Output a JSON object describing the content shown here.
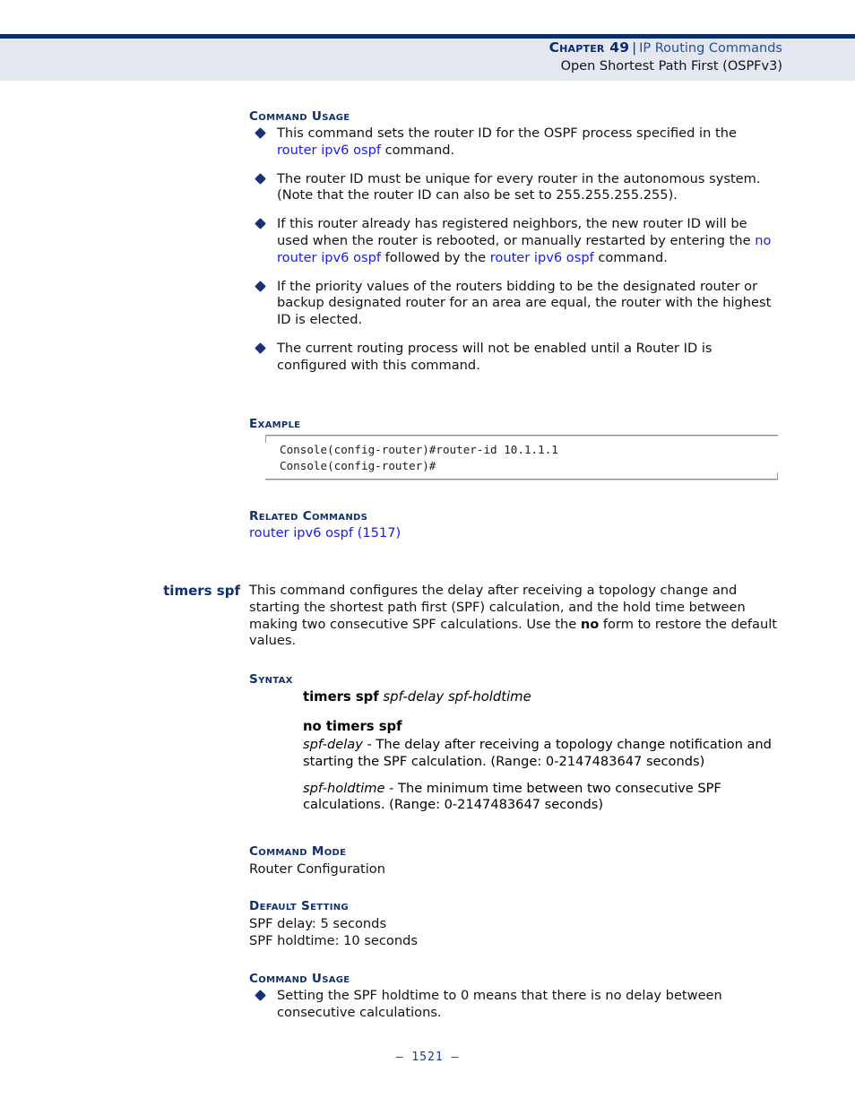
{
  "header": {
    "chapter_label": "Chapter 49",
    "separator": "|",
    "chapter_title": "IP Routing Commands",
    "subtitle": "Open Shortest Path First (OSPFv3)"
  },
  "colors": {
    "navy_rule": "#0a2b72",
    "header_band": "#e3e7f0",
    "heading_navy": "#10306e",
    "link_blue": "#1a1aee",
    "bullet_navy": "#17317a",
    "footer_navy": "#1b3a77"
  },
  "router_id_section": {
    "command_usage_label": "Command Usage",
    "bullets": [
      {
        "parts": [
          {
            "t": "This command sets the router ID for the OSPF process specified in the ",
            "s": "plain"
          },
          {
            "t": "router ipv6 ospf",
            "s": "link"
          },
          {
            "t": " command.",
            "s": "plain"
          }
        ]
      },
      {
        "parts": [
          {
            "t": "The router ID must be unique for every router in the autonomous system. (Note that the router ID can also be set to 255.255.255.255).",
            "s": "plain"
          }
        ]
      },
      {
        "parts": [
          {
            "t": "If this router already has registered neighbors, the new router ID will be used when the router is rebooted, or manually restarted by entering the ",
            "s": "plain"
          },
          {
            "t": "no router ipv6 ospf",
            "s": "link"
          },
          {
            "t": " followed by the ",
            "s": "plain"
          },
          {
            "t": "router ipv6 ospf",
            "s": "link"
          },
          {
            "t": " command.",
            "s": "plain"
          }
        ]
      },
      {
        "parts": [
          {
            "t": "If the priority values of the routers bidding to be the designated router or backup designated router for an area are equal, the router with the highest ID is elected.",
            "s": "plain"
          }
        ]
      },
      {
        "parts": [
          {
            "t": "The current routing process will not be enabled until a Router ID is configured with this command.",
            "s": "plain"
          }
        ]
      }
    ],
    "example_label": "Example",
    "example_console": "Console(config-router)#router-id 10.1.1.1\nConsole(config-router)#",
    "related_commands_label": "Related Commands",
    "related_commands_link": "router ipv6 ospf (1517)"
  },
  "timers_spf": {
    "command_name": "timers spf",
    "description_parts": [
      {
        "t": "This command configures the delay after receiving a topology change and starting the shortest path first (SPF) calculation, and the hold time between making two consecutive SPF calculations. Use the ",
        "s": "plain"
      },
      {
        "t": "no",
        "s": "bold"
      },
      {
        "t": " form to restore the default values.",
        "s": "plain"
      }
    ],
    "syntax_label": "Syntax",
    "syntax_line_1_parts": [
      {
        "t": "timers spf",
        "s": "bold"
      },
      {
        "t": " ",
        "s": "plain"
      },
      {
        "t": "spf-delay spf-holdtime",
        "s": "italic"
      }
    ],
    "syntax_line_2_parts": [
      {
        "t": "no timers spf",
        "s": "bold"
      }
    ],
    "params": [
      {
        "parts": [
          {
            "t": "spf-delay",
            "s": "italic"
          },
          {
            "t": " - The delay after receiving a topology change notification and starting the SPF calculation. (Range: 0-2147483647 seconds)",
            "s": "plain"
          }
        ]
      },
      {
        "parts": [
          {
            "t": "spf-holdtime",
            "s": "italic"
          },
          {
            "t": " - The minimum time between two consecutive SPF calculations. (Range: 0-2147483647 seconds)",
            "s": "plain"
          }
        ]
      }
    ],
    "command_mode_label": "Command Mode",
    "command_mode_value": "Router Configuration",
    "default_setting_label": "Default Setting",
    "default_setting_values": [
      "SPF delay: 5 seconds",
      "SPF holdtime: 10 seconds"
    ],
    "command_usage_label": "Command Usage",
    "command_usage_bullets": [
      {
        "parts": [
          {
            "t": "Setting the SPF holdtime to 0 means that there is no delay between consecutive calculations.",
            "s": "plain"
          }
        ]
      }
    ]
  },
  "footer": {
    "page_number": "–  1521  –"
  }
}
